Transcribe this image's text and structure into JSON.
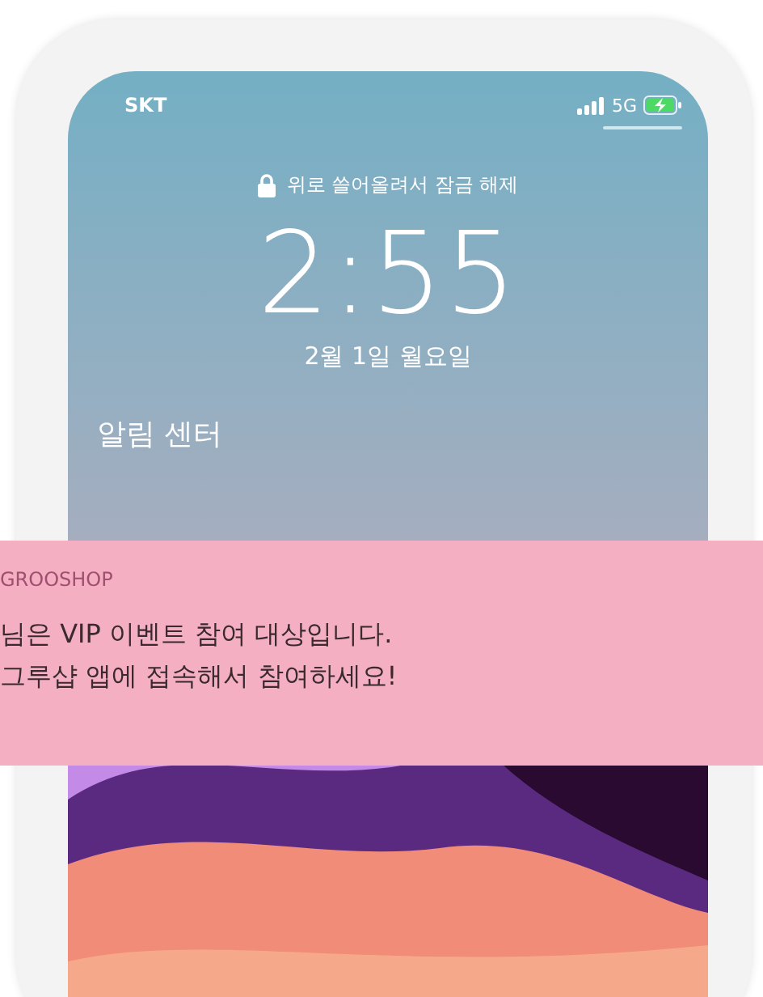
{
  "status_bar": {
    "carrier": "SKT",
    "network": "5G",
    "charging": true
  },
  "unlock_hint": "위로 쓸어올려서 잠금 해제",
  "time": "2:55",
  "date": "2월 1일 월요일",
  "notification_center_title": "알림 센터",
  "notification": {
    "app": "GROOSHOP",
    "lines": [
      "님은 VIP 이벤트 참여 대상입니다.",
      "그루샵 앱에 접속해서 참여하세요!"
    ]
  }
}
